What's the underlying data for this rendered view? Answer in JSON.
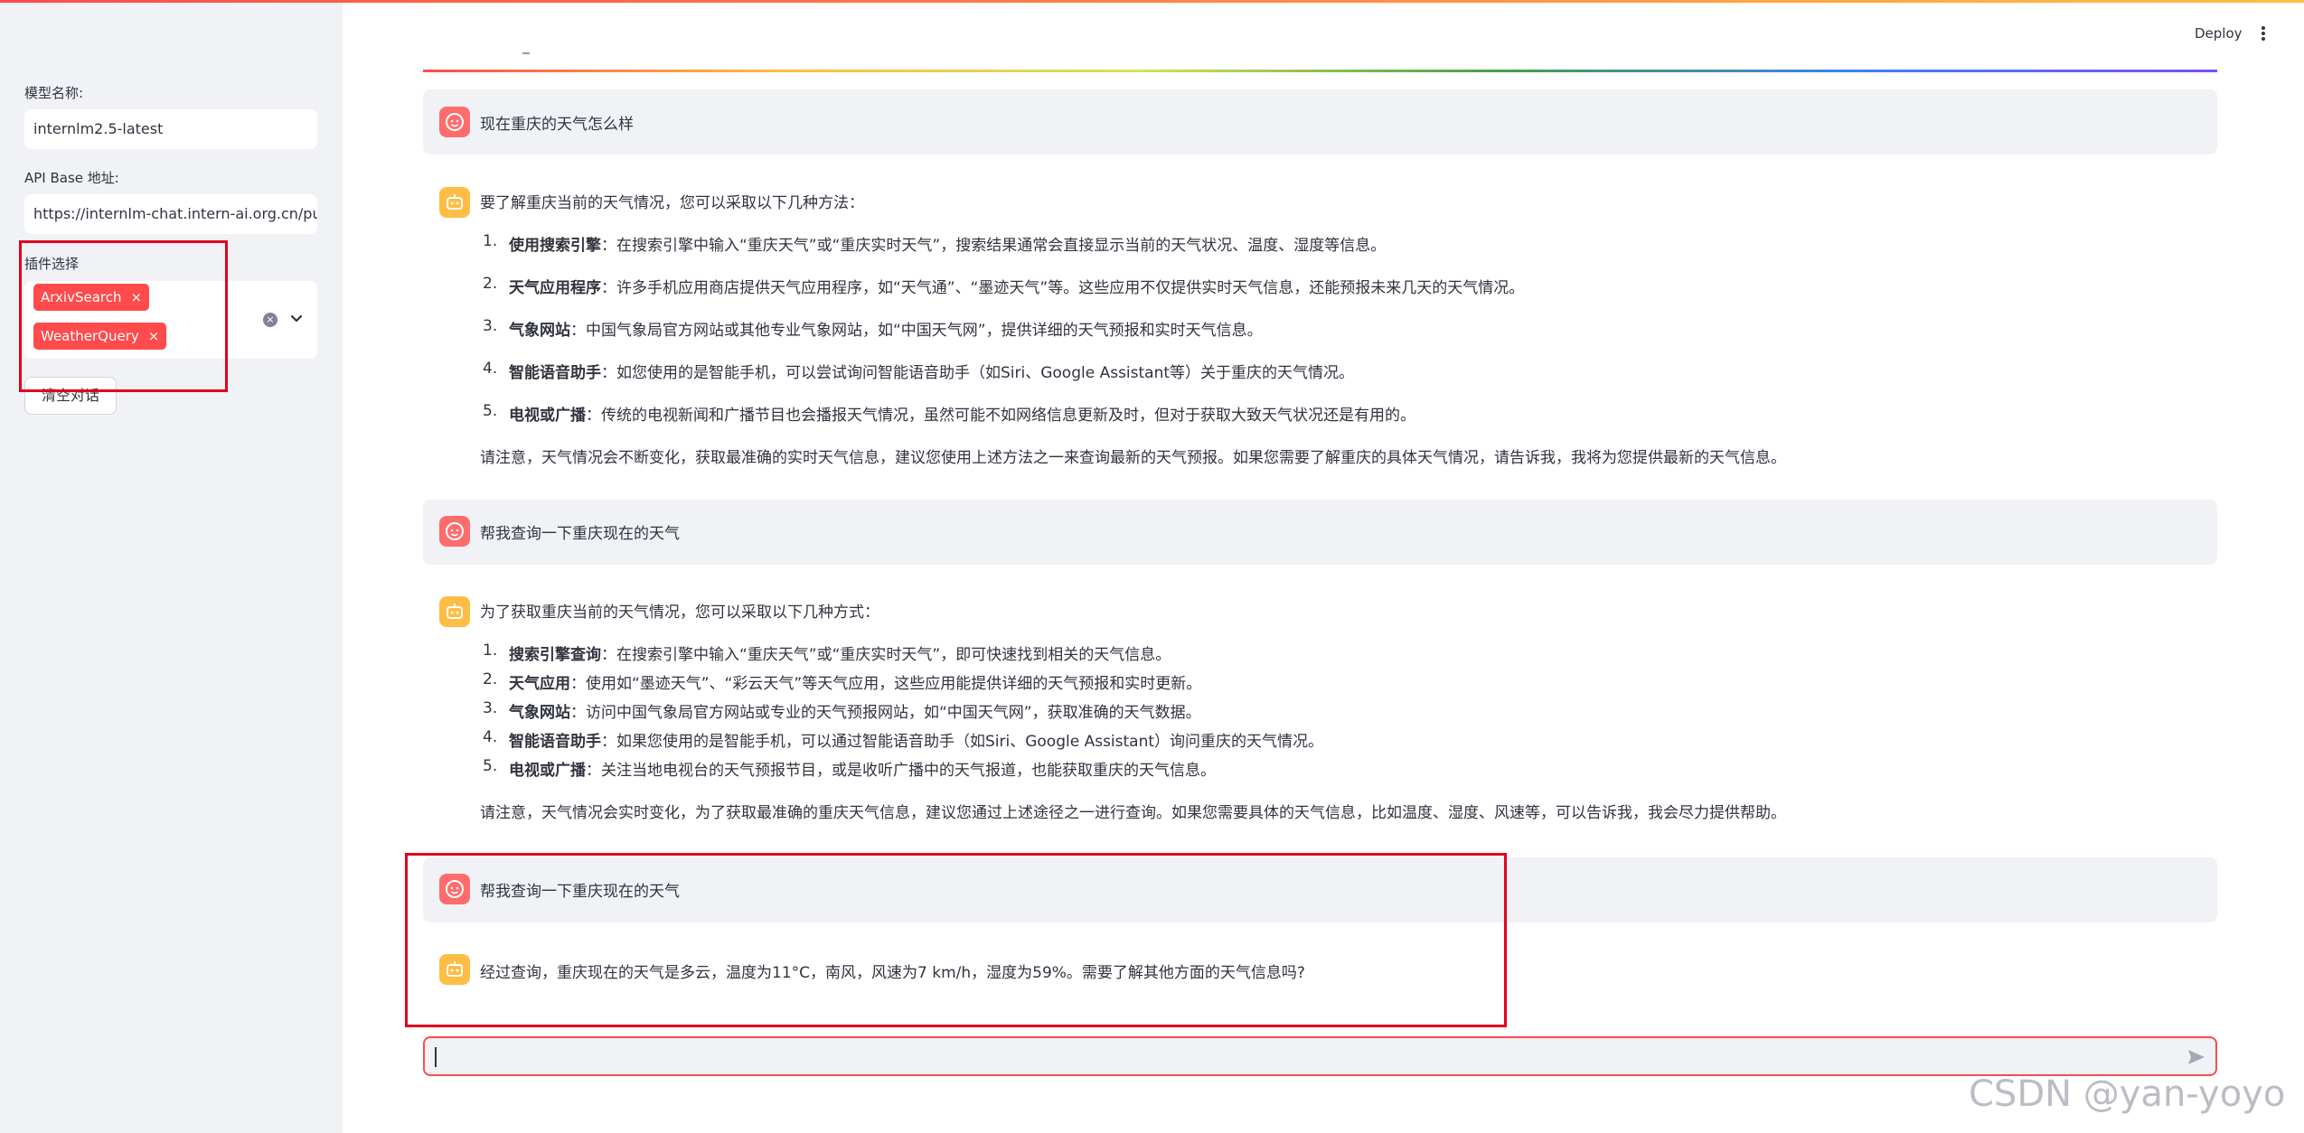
{
  "sidebar": {
    "model_label": "模型名称:",
    "model_value": "internlm2.5-latest",
    "api_label": "API Base 地址:",
    "api_value": "https://internlm-chat.intern-ai.org.cn/pu",
    "plugin_label": "插件选择",
    "plugins": [
      "ArxivSearch",
      "WeatherQuery"
    ],
    "chip_remove_glyph": "×",
    "clear_all_glyph": "×",
    "clear_button_label": "清空对话"
  },
  "header": {
    "deploy_label": "Deploy"
  },
  "chat": {
    "messages": [
      {
        "role": "user",
        "text": "现在重庆的天气怎么样"
      },
      {
        "role": "assistant",
        "intro": "要了解重庆当前的天气情况，您可以采取以下几种方法：",
        "items": [
          {
            "num": "1.",
            "bold": "使用搜索引擎",
            "text": "：在搜索引擎中输入“重庆天气”或“重庆实时天气”，搜索结果通常会直接显示当前的天气状况、温度、湿度等信息。"
          },
          {
            "num": "2.",
            "bold": "天气应用程序",
            "text": "：许多手机应用商店提供天气应用程序，如“天气通”、“墨迹天气”等。这些应用不仅提供实时天气信息，还能预报未来几天的天气情况。"
          },
          {
            "num": "3.",
            "bold": "气象网站",
            "text": "：中国气象局官方网站或其他专业气象网站，如“中国天气网”，提供详细的天气预报和实时天气信息。"
          },
          {
            "num": "4.",
            "bold": "智能语音助手",
            "text": "：如您使用的是智能手机，可以尝试询问智能语音助手（如Siri、Google Assistant等）关于重庆的天气情况。"
          },
          {
            "num": "5.",
            "bold": "电视或广播",
            "text": "：传统的电视新闻和广播节目也会播报天气情况，虽然可能不如网络信息更新及时，但对于获取大致天气状况还是有用的。"
          }
        ],
        "outro": "请注意，天气情况会不断变化，获取最准确的实时天气信息，建议您使用上述方法之一来查询最新的天气预报。如果您需要了解重庆的具体天气情况，请告诉我，我将为您提供最新的天气信息。"
      },
      {
        "role": "user",
        "text": "帮我查询一下重庆现在的天气"
      },
      {
        "role": "assistant",
        "intro": "为了获取重庆当前的天气情况，您可以采取以下几种方式：",
        "items": [
          {
            "num": "1.",
            "bold": "搜索引擎查询",
            "text": "：在搜索引擎中输入“重庆天气”或“重庆实时天气”，即可快速找到相关的天气信息。"
          },
          {
            "num": "2.",
            "bold": "天气应用",
            "text": "：使用如“墨迹天气”、“彩云天气”等天气应用，这些应用能提供详细的天气预报和实时更新。"
          },
          {
            "num": "3.",
            "bold": "气象网站",
            "text": "：访问中国气象局官方网站或专业的天气预报网站，如“中国天气网”，获取准确的天气数据。"
          },
          {
            "num": "4.",
            "bold": "智能语音助手",
            "text": "：如果您使用的是智能手机，可以通过智能语音助手（如Siri、Google Assistant）询问重庆的天气情况。"
          },
          {
            "num": "5.",
            "bold": "电视或广播",
            "text": "：关注当地电视台的天气预报节目，或是收听广播中的天气报道，也能获取重庆的天气信息。"
          }
        ],
        "outro": "请注意，天气情况会实时变化，为了获取最准确的重庆天气信息，建议您通过上述途径之一进行查询。如果您需要具体的天气信息，比如温度、湿度、风速等，可以告诉我，我会尽力提供帮助。"
      },
      {
        "role": "user",
        "text": "帮我查询一下重庆现在的天气"
      },
      {
        "role": "assistant",
        "intro": "经过查询，重庆现在的天气是多云，温度为11°C，南风，风速为7 km/h，湿度为59%。需要了解其他方面的天气信息吗?"
      }
    ]
  },
  "input": {
    "placeholder": ""
  },
  "watermark": "CSDN @yan-yoyo",
  "colors": {
    "accent": "#ff4b4b",
    "bot_avatar": "#ffbd45",
    "user_avatar": "#ff6c6c",
    "annotation": "#e3001b",
    "sidebar_bg": "#f0f2f6"
  }
}
